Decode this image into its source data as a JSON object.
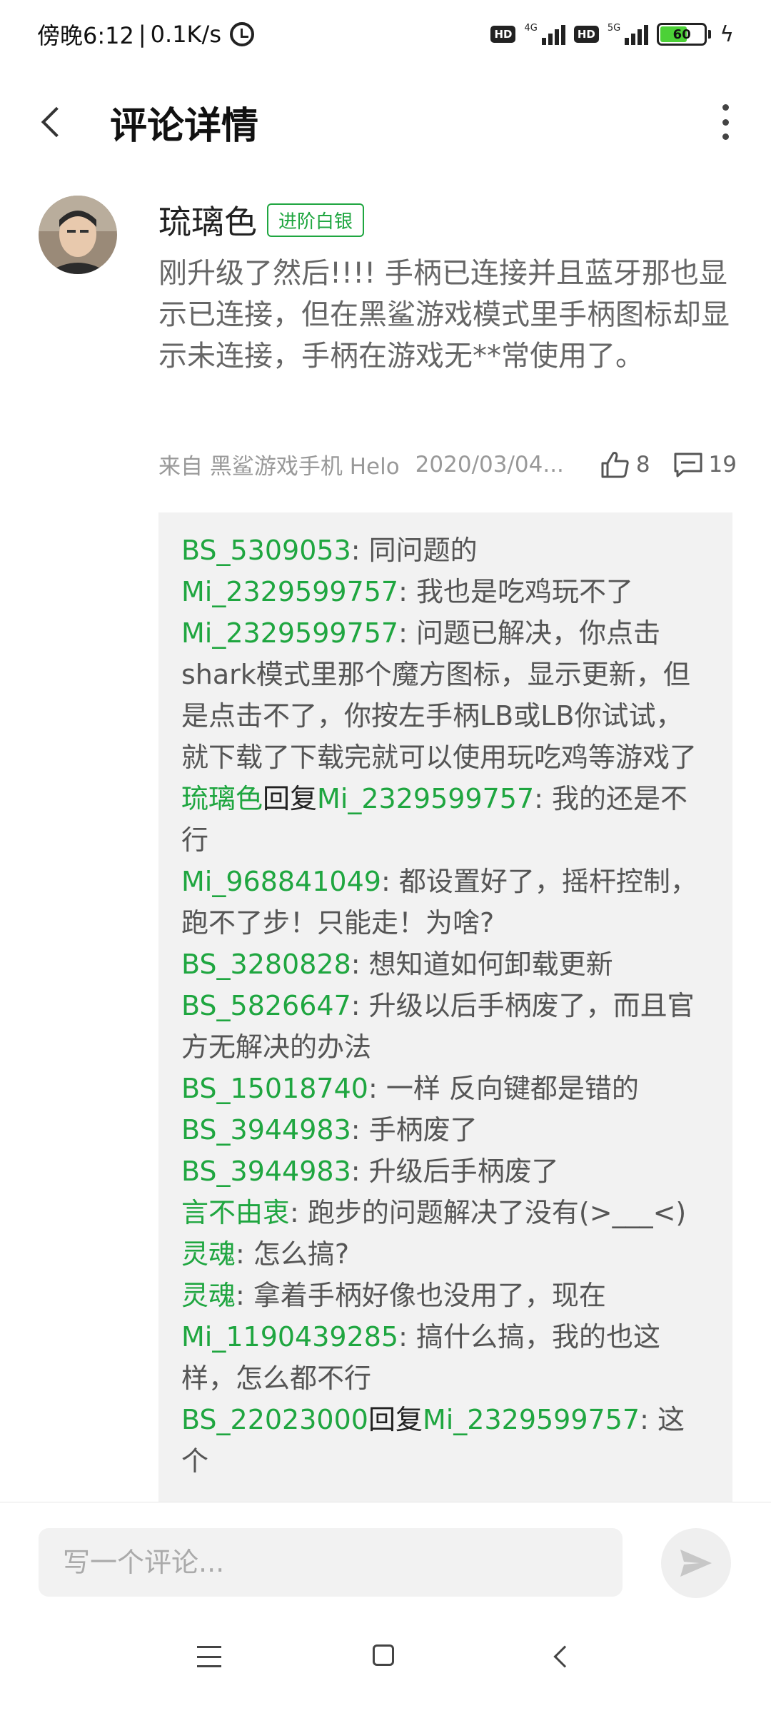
{
  "status_bar": {
    "time": "傍晚6:12",
    "network_speed": "0.1K/s",
    "sim1_tag": "HD",
    "sim1_network": "4G",
    "sim2_tag": "HD",
    "sim2_network": "5G",
    "battery": "60",
    "battery_level_percent": 60,
    "icons": [
      "alarm-icon",
      "signal-icon",
      "battery-icon",
      "charging-icon"
    ]
  },
  "header": {
    "title": "评论详情",
    "icons": [
      "back-icon",
      "more-icon"
    ]
  },
  "comment": {
    "author": "琉璃色",
    "level_badge": "进阶白银",
    "text": "刚升级了然后!!!! 手柄已连接并且蓝牙那也显示已连接，但在黑鲨游戏模式里手柄图标却显示未连接，手柄在游戏无**常使用了。",
    "source": "来自 黑鲨游戏手机 Helo",
    "time": "2020/03/04...",
    "likes": "8",
    "replies_count": "19",
    "icons": [
      "avatar",
      "like-icon",
      "reply-icon"
    ]
  },
  "colors": {
    "accent_green": "#1fa640",
    "reply_background": "#f2f2f2",
    "text_gray": "#666666",
    "meta_gray": "#999999"
  },
  "replies": [
    {
      "user": "BS_5309053",
      "text": "同问题的"
    },
    {
      "user": "Mi_2329599757",
      "text": "我也是吃鸡玩不了"
    },
    {
      "user": "Mi_2329599757",
      "text": "问题已解决，你点击shark模式里那个魔方图标，显示更新，但是点击不了，你按左手柄LB或LB你试试，就下载了下载完就可以使用玩吃鸡等游戏了"
    },
    {
      "user": "琉璃色",
      "reply_word": "回复",
      "reply_to": "Mi_2329599757",
      "text": "我的还是不行"
    },
    {
      "user": "Mi_968841049",
      "text": "都设置好了，摇杆控制，跑不了步！只能走！为啥?"
    },
    {
      "user": "BS_3280828",
      "text": "想知道如何卸载更新"
    },
    {
      "user": "BS_5826647",
      "text": "升级以后手柄废了，而且官方无解决的办法"
    },
    {
      "user": "BS_15018740",
      "text": "一样   反向键都是错的"
    },
    {
      "user": "BS_3944983",
      "text": "手柄废了"
    },
    {
      "user": "BS_3944983",
      "text": "升级后手柄废了"
    },
    {
      "user": "言不由衷",
      "text": "跑步的问题解决了没有(>___<)"
    },
    {
      "user": "灵魂",
      "text": "怎么搞?"
    },
    {
      "user": "灵魂",
      "text": "拿着手柄好像也没用了，现在"
    },
    {
      "user": "Mi_1190439285",
      "text": "搞什么搞，我的也这样，怎么都不行"
    },
    {
      "user": "BS_22023000",
      "reply_word": "回复",
      "reply_to": "Mi_2329599757",
      "text": "这个"
    }
  ],
  "input": {
    "placeholder": "写一个评论..."
  },
  "bottom_icons": [
    "send-icon",
    "nav-menu-icon",
    "nav-home-icon",
    "nav-back-icon"
  ],
  "reply_separator": ": "
}
